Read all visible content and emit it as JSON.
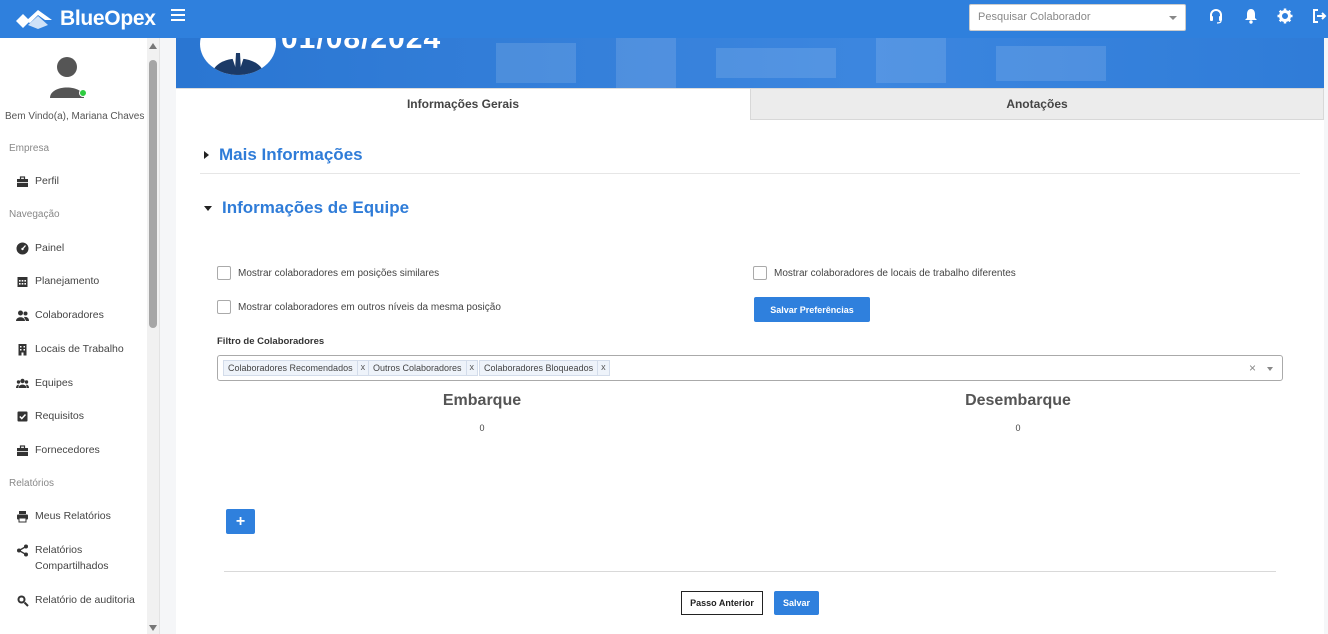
{
  "app": {
    "name": "BlueOpex"
  },
  "topbar": {
    "search_placeholder": "Pesquisar Colaborador",
    "icons": [
      "headset-icon",
      "bell-icon",
      "gear-icon",
      "logout-icon"
    ]
  },
  "sidebar": {
    "welcome": "Bem Vindo(a), Mariana Chaves",
    "sections": {
      "empresa": "Empresa",
      "navegacao": "Navegação",
      "relatorios": "Relatórios"
    },
    "items": [
      {
        "label": "Perfil",
        "icon": "briefcase-icon"
      },
      {
        "label": "Painel",
        "icon": "dashboard-icon"
      },
      {
        "label": "Planejamento",
        "icon": "calendar-icon"
      },
      {
        "label": "Colaboradores",
        "icon": "users-icon"
      },
      {
        "label": "Locais de Trabalho",
        "icon": "building-icon"
      },
      {
        "label": "Equipes",
        "icon": "team-icon"
      },
      {
        "label": "Requisitos",
        "icon": "checkbox-icon"
      },
      {
        "label": "Fornecedores",
        "icon": "briefcase-icon"
      },
      {
        "label": "Meus Relatórios",
        "icon": "printer-icon"
      },
      {
        "label": "Relatórios Compartilhados",
        "icon": "share-icon"
      },
      {
        "label": "Relatório de auditoria",
        "icon": "search-doc-icon"
      }
    ]
  },
  "banner": {
    "date": "01/08/2024"
  },
  "tabs": [
    {
      "label": "Informações Gerais",
      "active": true
    },
    {
      "label": "Anotações",
      "active": false
    }
  ],
  "sections": {
    "more_info": "Mais Informações",
    "team_info": "Informações de Equipe"
  },
  "options": {
    "similar_positions": "Mostrar colaboradores em posições similares",
    "other_levels": "Mostrar colaboradores em outros níveis da mesma posição",
    "different_locations": "Mostrar colaboradores de locais de trabalho diferentes",
    "save_prefs": "Salvar Preferências"
  },
  "filter": {
    "label": "Filtro de Colaboradores",
    "tags": [
      "Colaboradores Recomendados",
      "Outros Colaboradores",
      "Colaboradores Bloqueados"
    ],
    "remove_symbol": "x",
    "clear_symbol": "×"
  },
  "columns": {
    "embarque": {
      "title": "Embarque",
      "count": "0"
    },
    "desembarque": {
      "title": "Desembarque",
      "count": "0"
    }
  },
  "actions": {
    "add": "+",
    "previous": "Passo Anterior",
    "save": "Salvar"
  },
  "colors": {
    "primary": "#2f80dd",
    "link": "#2f7cd8",
    "online": "#2ecc40"
  }
}
